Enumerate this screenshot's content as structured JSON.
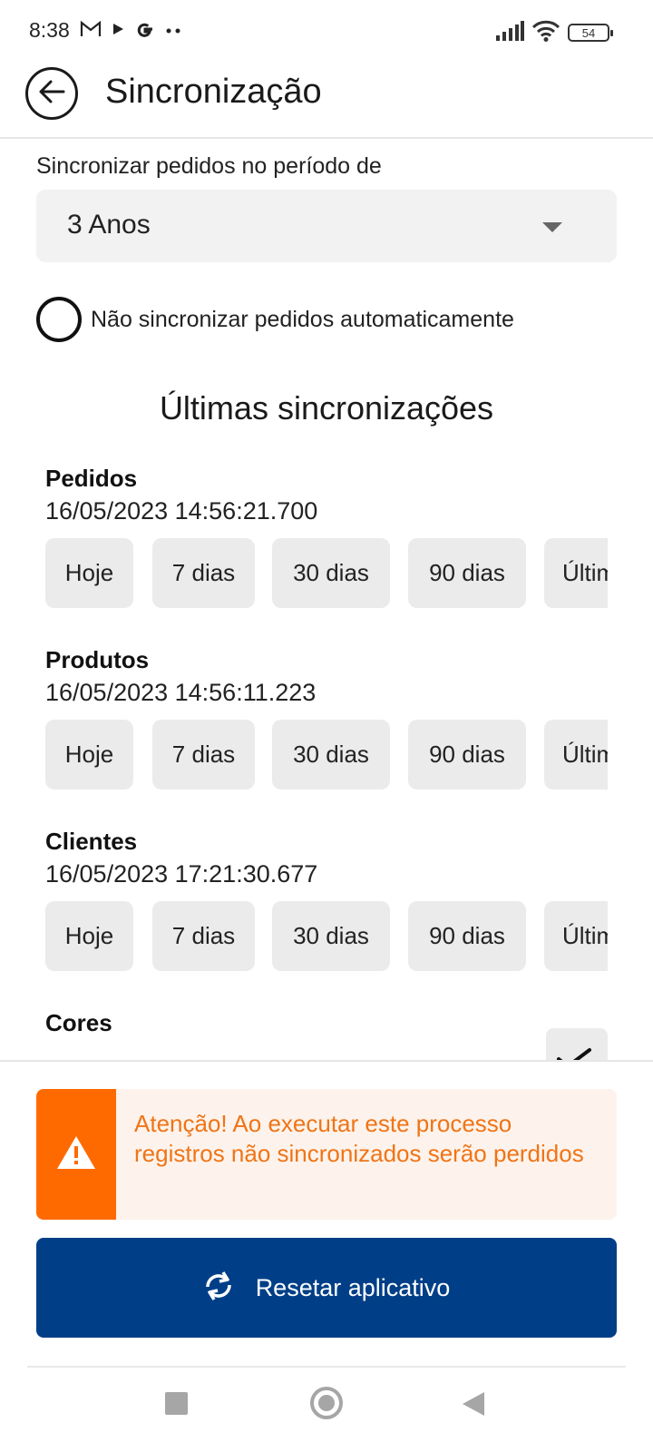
{
  "status_bar": {
    "time": "8:38",
    "left_icons": [
      "gmail-icon",
      "play-icon",
      "google-icon",
      "more-dots-icon"
    ],
    "right_icons": [
      "signal-icon",
      "wifi-icon",
      "battery-icon"
    ],
    "battery_level": "54"
  },
  "header": {
    "title": "Sincronização",
    "back_icon": "arrow-left-icon"
  },
  "settings": {
    "period_label": "Sincronizar pedidos no período de",
    "period_value": "3 Anos",
    "no_auto_sync_label": "Não sincronizar pedidos automaticamente",
    "no_auto_sync_checked": false
  },
  "last_syncs": {
    "title": "Últimas sincronizações",
    "entities": [
      {
        "name": "Pedidos",
        "date": "16/05/2023 14:56:21.700",
        "chips": [
          "Hoje",
          "7 dias",
          "30 dias",
          "90 dias",
          "Últim"
        ]
      },
      {
        "name": "Produtos",
        "date": "16/05/2023 14:56:11.223",
        "chips": [
          "Hoje",
          "7 dias",
          "30 dias",
          "90 dias",
          "Últim"
        ]
      },
      {
        "name": "Clientes",
        "date": "16/05/2023 17:21:30.677",
        "chips": [
          "Hoje",
          "7 dias",
          "30 dias",
          "90 dias",
          "Últim"
        ]
      },
      {
        "name": "Cores",
        "date": "",
        "chips": []
      }
    ]
  },
  "warning": {
    "icon": "warning-triangle-icon",
    "text": "Atenção! Ao executar este processo registros não sincronizados serão perdidos"
  },
  "reset_button": {
    "icon": "sync-icon",
    "label": "Resetar aplicativo"
  },
  "colors": {
    "primary": "#003f87",
    "warning_accent": "#ff6a00",
    "warning_text": "#f07416",
    "warning_bg": "#fdf3ec",
    "chip_bg": "#ebebeb"
  }
}
